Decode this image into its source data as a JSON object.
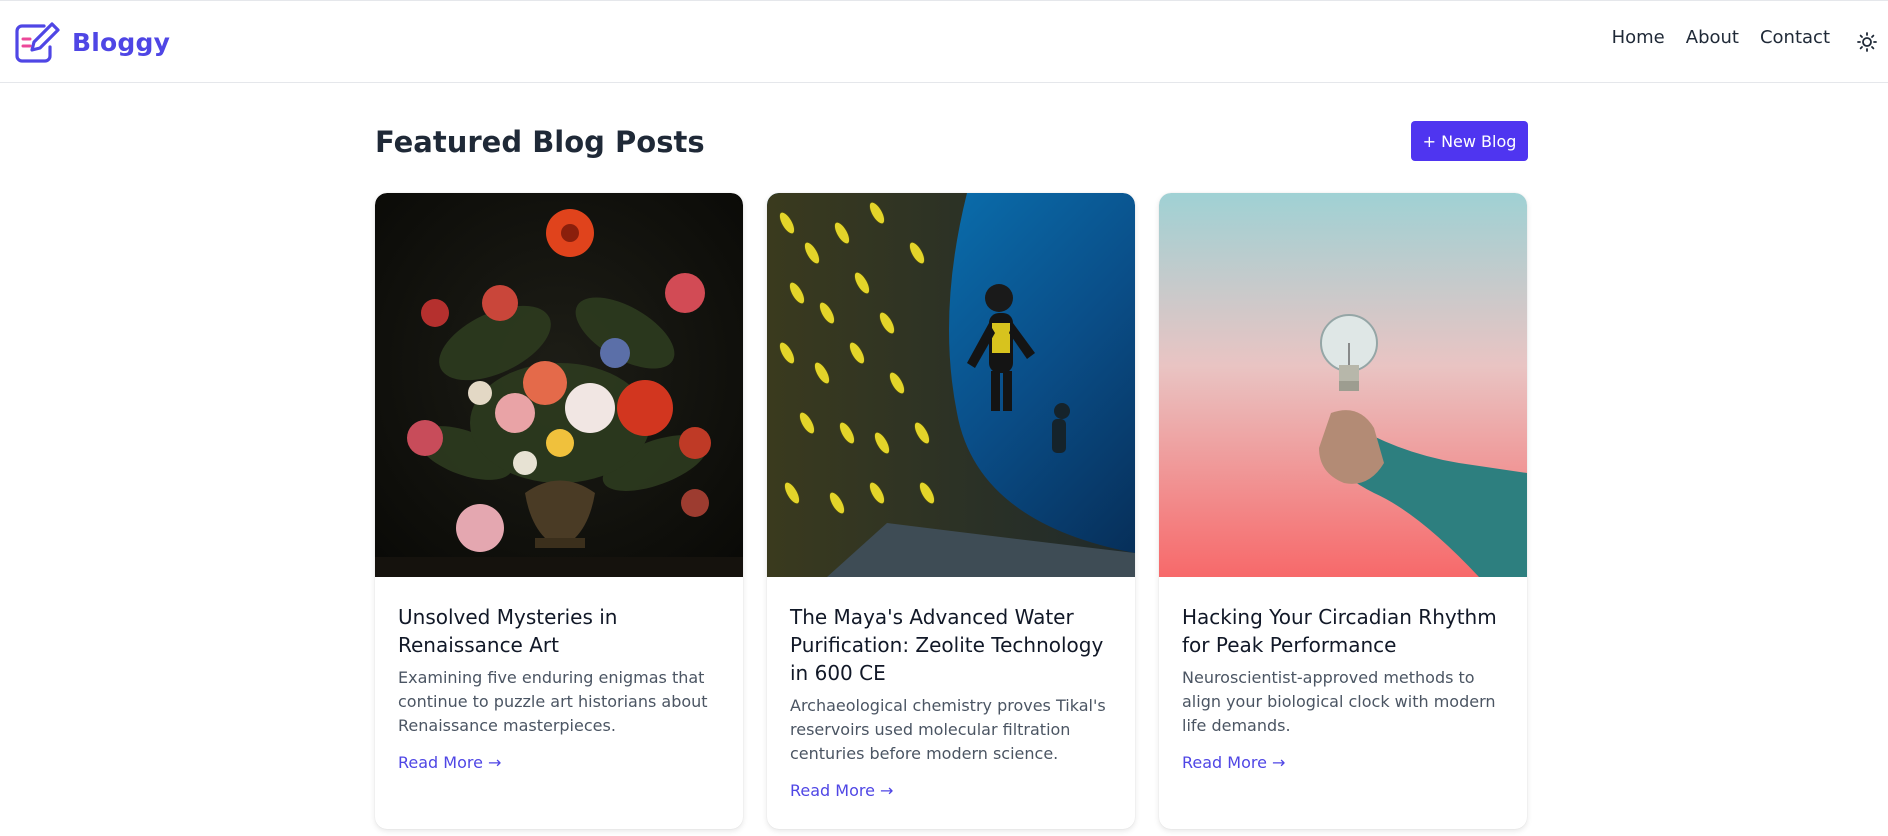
{
  "header": {
    "brand": "Bloggy",
    "nav": [
      {
        "label": "Home"
      },
      {
        "label": "About"
      },
      {
        "label": "Contact"
      }
    ],
    "theme_icon": "sun-icon"
  },
  "main": {
    "title": "Featured Blog Posts",
    "new_blog_label": "+ New Blog",
    "posts": [
      {
        "title": "Unsolved Mysteries in Renaissance Art",
        "description": "Examining five enduring enigmas that continue to puzzle art historians about Renaissance masterpieces.",
        "link": "Read More →",
        "image": "flower-still-life-painting"
      },
      {
        "title": "The Maya's Advanced Water Purification: Zeolite Technology in 600 CE",
        "description": "Archaeological chemistry proves Tikal's reservoirs used molecular filtration centuries before modern science.",
        "link": "Read More →",
        "image": "scuba-diver-with-fish"
      },
      {
        "title": "Hacking Your Circadian Rhythm for Peak Performance",
        "description": "Neuroscientist-approved methods to align your biological clock with modern life demands.",
        "link": "Read More →",
        "image": "hand-holding-light-bulb"
      }
    ]
  },
  "colors": {
    "brand": "#4f46e5",
    "button": "#4f35f0",
    "text": "#111827",
    "muted": "#4b5563"
  }
}
